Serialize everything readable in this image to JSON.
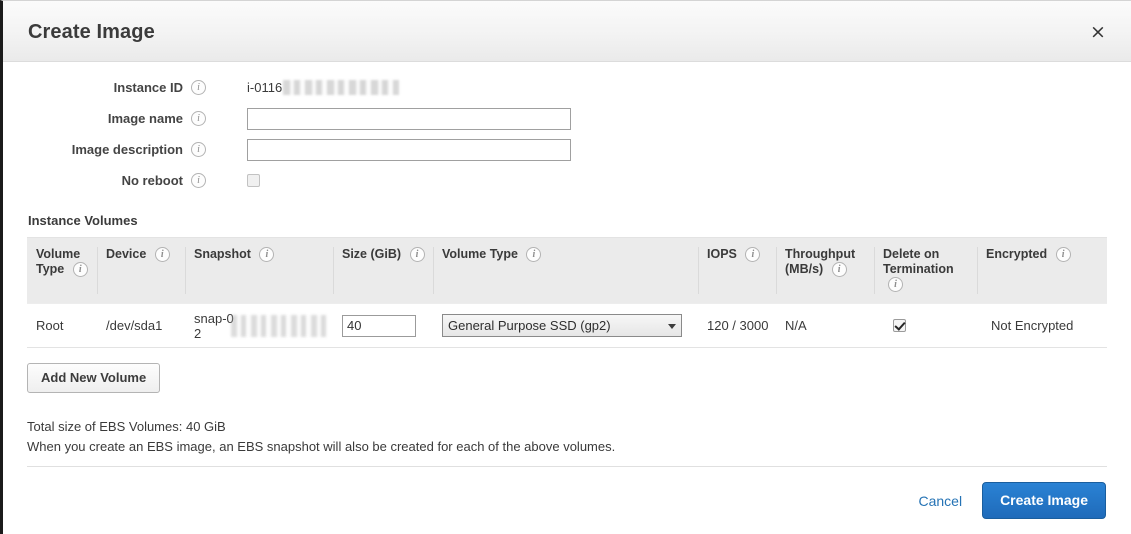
{
  "dialog": {
    "title": "Create Image",
    "close_label": "×"
  },
  "form": {
    "fields": [
      {
        "label": "Instance ID",
        "value": "i-0116",
        "redacted": true
      },
      {
        "label": "Image name",
        "value": "",
        "placeholder": ""
      },
      {
        "label": "Image description",
        "value": "",
        "placeholder": ""
      },
      {
        "label": "No reboot",
        "checked": false
      }
    ]
  },
  "volumes_section": {
    "title": "Instance Volumes",
    "columns": [
      "Volume Type",
      "Device",
      "Snapshot",
      "Size (GiB)",
      "Volume Type",
      "IOPS",
      "Throughput (MB/s)",
      "Delete on Termination",
      "Encrypted"
    ],
    "rows": [
      {
        "volume_type": "Root",
        "device": "/dev/sda1",
        "snapshot": "snap-02",
        "size": "40",
        "type_selected": "General Purpose SSD (gp2)",
        "iops": "120 / 3000",
        "throughput": "N/A",
        "delete_on_termination": true,
        "encrypted": "Not Encrypted"
      }
    ],
    "add_button": "Add New Volume"
  },
  "summary": {
    "total": "Total size of EBS Volumes: 40 GiB",
    "note": "When you create an EBS image, an EBS snapshot will also be created for each of the above volumes."
  },
  "footer": {
    "cancel": "Cancel",
    "create": "Create Image"
  },
  "colors": {
    "accent": "#1f6bba",
    "link": "#2573b5",
    "header_bg": "#f3f3f3",
    "table_header_bg": "#ebebeb"
  }
}
